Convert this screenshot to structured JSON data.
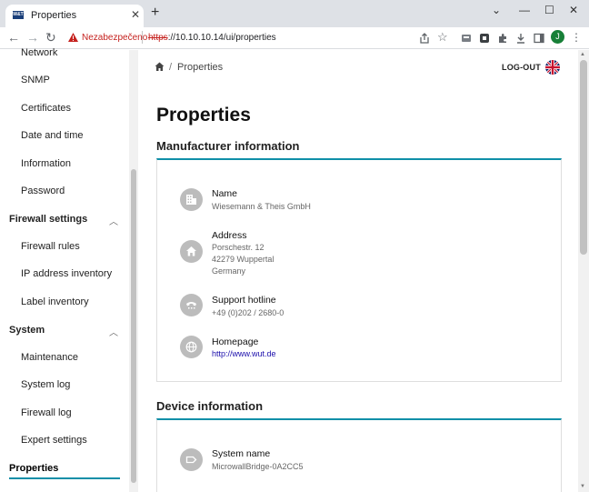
{
  "browser": {
    "tab_title": "Properties",
    "tab_favicon_text": "W&T",
    "not_secure_label": "Nezabezpečeno",
    "url_scheme": "https",
    "url_rest": "://10.10.10.14/ui/properties",
    "profile_initial": "J"
  },
  "sidebar": {
    "items_top": [
      "Network",
      "SNMP",
      "Certificates",
      "Date and time",
      "Information",
      "Password"
    ],
    "group_firewall": "Firewall settings",
    "items_firewall": [
      "Firewall rules",
      "IP address inventory",
      "Label inventory"
    ],
    "group_system": "System",
    "items_system": [
      "Maintenance",
      "System log",
      "Firewall log",
      "Expert settings"
    ],
    "active": "Properties"
  },
  "header": {
    "breadcrumb_page": "Properties",
    "breadcrumb_sep": "/",
    "logout": "LOG-OUT"
  },
  "page": {
    "title": "Properties"
  },
  "manufacturer": {
    "title": "Manufacturer information",
    "name_label": "Name",
    "name_value": "Wiesemann & Theis GmbH",
    "address_label": "Address",
    "address_lines": [
      "Porschestr. 12",
      "42279 Wuppertal",
      "Germany"
    ],
    "hotline_label": "Support hotline",
    "hotline_value": "+49 (0)202 / 2680-0",
    "homepage_label": "Homepage",
    "homepage_value": "http://www.wut.de"
  },
  "device": {
    "title": "Device information",
    "system_name_label": "System name",
    "system_name_value": "MicrowallBridge-0A2CC5"
  },
  "colors": {
    "accent": "#0f8fa8",
    "icon_gray": "#bcbcbc",
    "link": "#1a0dab",
    "warning": "#c5221f"
  }
}
